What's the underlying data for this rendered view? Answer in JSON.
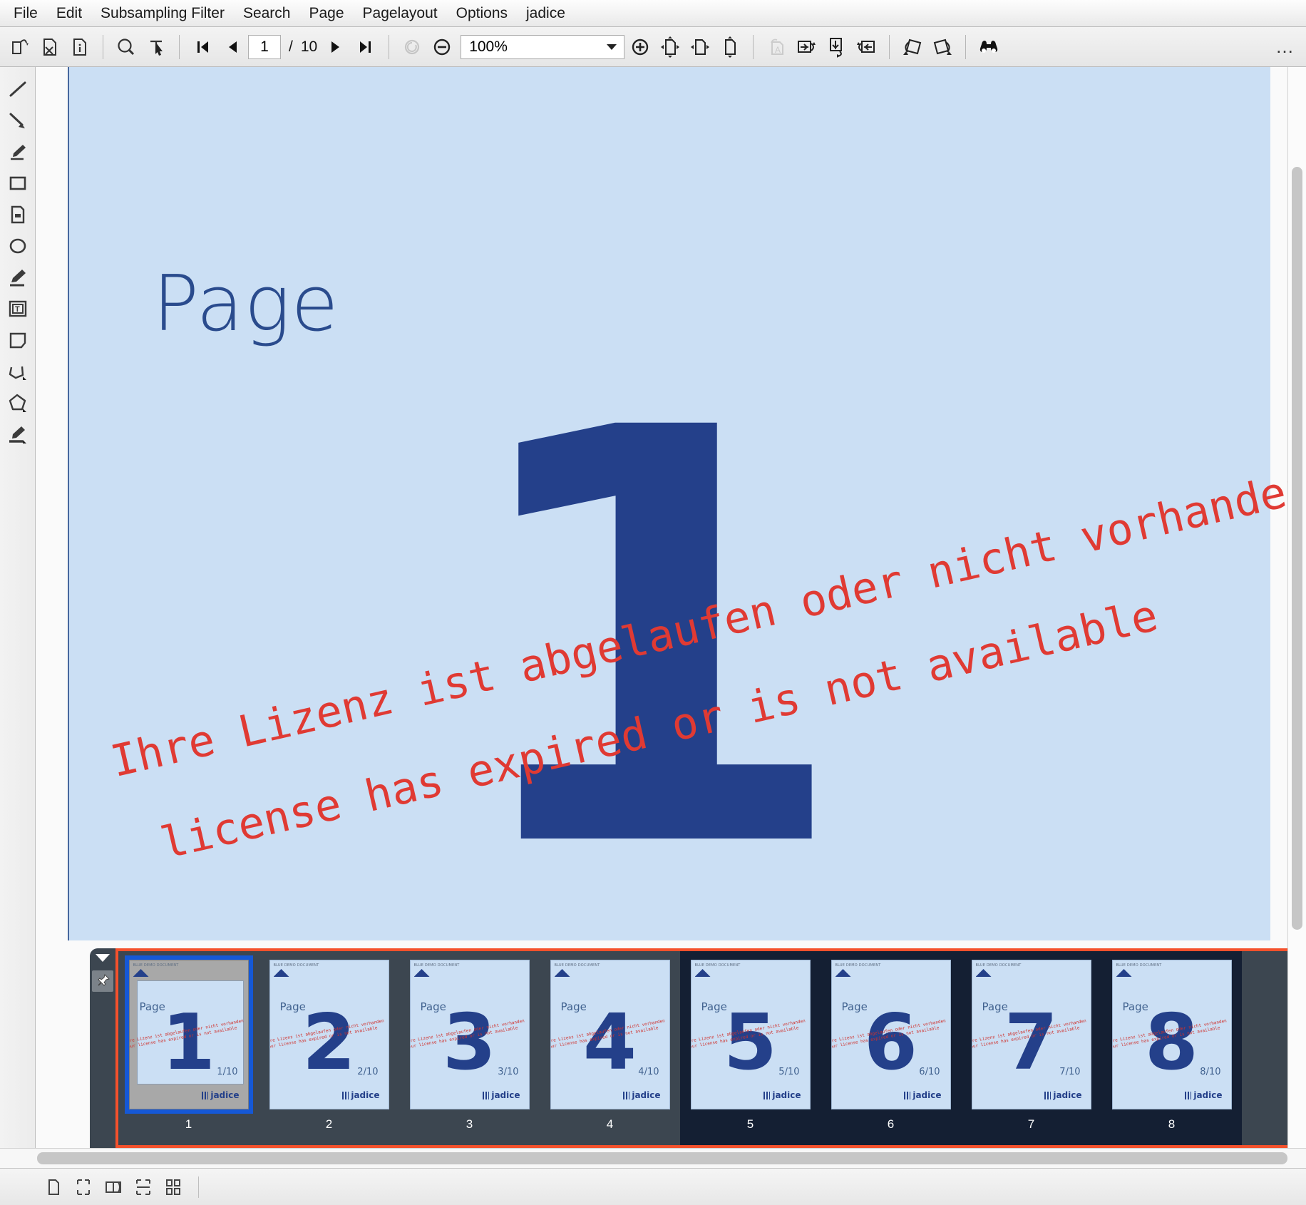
{
  "menubar": {
    "items": [
      {
        "label": "File",
        "name": "menu-file"
      },
      {
        "label": "Edit",
        "name": "menu-edit"
      },
      {
        "label": "Subsampling Filter",
        "name": "menu-subsampling-filter"
      },
      {
        "label": "Search",
        "name": "menu-search"
      },
      {
        "label": "Page",
        "name": "menu-page"
      },
      {
        "label": "Pagelayout",
        "name": "menu-pagelayout"
      },
      {
        "label": "Options",
        "name": "menu-options"
      },
      {
        "label": "jadice",
        "name": "menu-jadice"
      }
    ]
  },
  "toolbar": {
    "icons": [
      "open-document-icon",
      "close-document-icon",
      "document-info-icon",
      "magnifier-zoom-icon",
      "text-select-cursor-icon",
      "first-page-icon",
      "previous-page-icon",
      "next-page-icon",
      "last-page-icon",
      "reset-rotation-icon",
      "zoom-out-icon",
      "zoom-in-icon",
      "fit-page-icon",
      "fit-width-icon",
      "fit-height-icon",
      "rotate-page-text-icon",
      "rotate-forward-icon",
      "rotate-down-icon",
      "rotate-back-icon",
      "rotate-clockwise-icon",
      "rotate-counterclockwise-icon",
      "binoculars-icon"
    ],
    "page_current": "1",
    "page_separator": "/",
    "page_total": "10",
    "zoom_value": "100%",
    "overflow_label": "…"
  },
  "sidebar": {
    "tools": [
      {
        "name": "line-tool",
        "label": "Line"
      },
      {
        "name": "arrow-tool",
        "label": "Arrow"
      },
      {
        "name": "pen-tool",
        "label": "Pen"
      },
      {
        "name": "rectangle-tool",
        "label": "Rectangle"
      },
      {
        "name": "filled-note-tool",
        "label": "Filled note"
      },
      {
        "name": "ellipse-tool",
        "label": "Ellipse"
      },
      {
        "name": "highlighter-tool",
        "label": "Highlighter"
      },
      {
        "name": "text-annotation-tool",
        "label": "Text"
      },
      {
        "name": "sticky-note-tool",
        "label": "Note"
      },
      {
        "name": "polyline-tool",
        "label": "Polyline"
      },
      {
        "name": "polygon-tool",
        "label": "Polygon"
      },
      {
        "name": "stamp-tool",
        "label": "Stamp"
      }
    ]
  },
  "document": {
    "page_label": "Page",
    "page_number": "1",
    "watermark_de": "Ihre Lizenz ist abgelaufen oder nicht vorhanden",
    "watermark_en": "license has expired or is not available"
  },
  "thumbnails": {
    "collapse_icon": "triangle-down-icon",
    "pin_icon": "pin-icon",
    "page_total": "10",
    "items": [
      {
        "number": "1",
        "label": "1",
        "fraction": "1/10",
        "selected": true,
        "highlighted": false
      },
      {
        "number": "2",
        "label": "2",
        "fraction": "2/10",
        "selected": false,
        "highlighted": false
      },
      {
        "number": "3",
        "label": "3",
        "fraction": "3/10",
        "selected": false,
        "highlighted": false
      },
      {
        "number": "4",
        "label": "4",
        "fraction": "4/10",
        "selected": false,
        "highlighted": false
      },
      {
        "number": "5",
        "label": "5",
        "fraction": "5/10",
        "selected": false,
        "highlighted": true
      },
      {
        "number": "6",
        "label": "6",
        "fraction": "6/10",
        "selected": false,
        "highlighted": true
      },
      {
        "number": "7",
        "label": "7",
        "fraction": "7/10",
        "selected": false,
        "highlighted": true
      },
      {
        "number": "8",
        "label": "8",
        "fraction": "8/10",
        "selected": false,
        "highlighted": true
      }
    ],
    "thumb_page_label": "Page",
    "thumb_header_text": "BLUE DEMO DOCUMENT",
    "thumb_logo_text": "jadice",
    "thumb_watermark_line1": "Ihre Lizenz ist abgelaufen oder nicht vorhanden",
    "thumb_watermark_line2": "Your license has expired or is not available"
  },
  "statusbar": {
    "layout_buttons": [
      {
        "name": "layout-single-page-icon",
        "label": "Single page"
      },
      {
        "name": "layout-continuous-icon",
        "label": "Continuous"
      },
      {
        "name": "layout-double-page-icon",
        "label": "Double page"
      },
      {
        "name": "layout-continuous-double-icon",
        "label": "Continuous double"
      },
      {
        "name": "layout-grid-icon",
        "label": "Grid"
      }
    ]
  },
  "colors": {
    "page_bg": "#cbdff4",
    "accent_navy": "#24408a",
    "watermark_red": "#e03a33",
    "selection_blue": "#1558d6",
    "panel_dark": "#3c4650",
    "strip_border": "#f4512c"
  }
}
